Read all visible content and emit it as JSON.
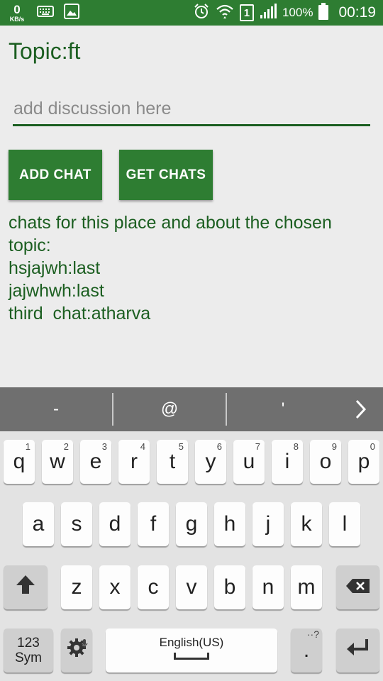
{
  "status_bar": {
    "speed_value": "0",
    "speed_unit": "KB/s",
    "battery": "100%",
    "sim_slot": "1",
    "time": "00:19",
    "icons": [
      "keyboard-icon",
      "image-icon",
      "alarm-icon",
      "wifi-icon",
      "sim-icon",
      "signal-icon",
      "battery-icon"
    ]
  },
  "app": {
    "topic": "Topic:ft",
    "input": {
      "placeholder": "add discussion here",
      "value": ""
    },
    "buttons": {
      "add_chat": "ADD CHAT",
      "get_chats": "GET CHATS"
    },
    "chats_header_line1": "chats for this place and about the chosen",
    "chats_header_line2": "topic:",
    "chats": [
      "hsjajwh:last",
      "jajwhwh:last",
      "third  chat:atharva"
    ],
    "colors": {
      "primary": "#2e7d32",
      "text": "#1b5e20",
      "background": "#ececec"
    }
  },
  "keyboard": {
    "suggestions": [
      "-",
      "@",
      "'"
    ],
    "row1": [
      {
        "key": "q",
        "hint": "1"
      },
      {
        "key": "w",
        "hint": "2"
      },
      {
        "key": "e",
        "hint": "3"
      },
      {
        "key": "r",
        "hint": "4"
      },
      {
        "key": "t",
        "hint": "5"
      },
      {
        "key": "y",
        "hint": "6"
      },
      {
        "key": "u",
        "hint": "7"
      },
      {
        "key": "i",
        "hint": "8"
      },
      {
        "key": "o",
        "hint": "9"
      },
      {
        "key": "p",
        "hint": "0"
      }
    ],
    "row2": [
      "a",
      "s",
      "d",
      "f",
      "g",
      "h",
      "j",
      "k",
      "l"
    ],
    "row3": [
      "z",
      "x",
      "c",
      "v",
      "b",
      "n",
      "m"
    ],
    "sym_line1": "123",
    "sym_line2": "Sym",
    "space_label": "English(US)",
    "period": ".",
    "period_hint": "··?"
  }
}
